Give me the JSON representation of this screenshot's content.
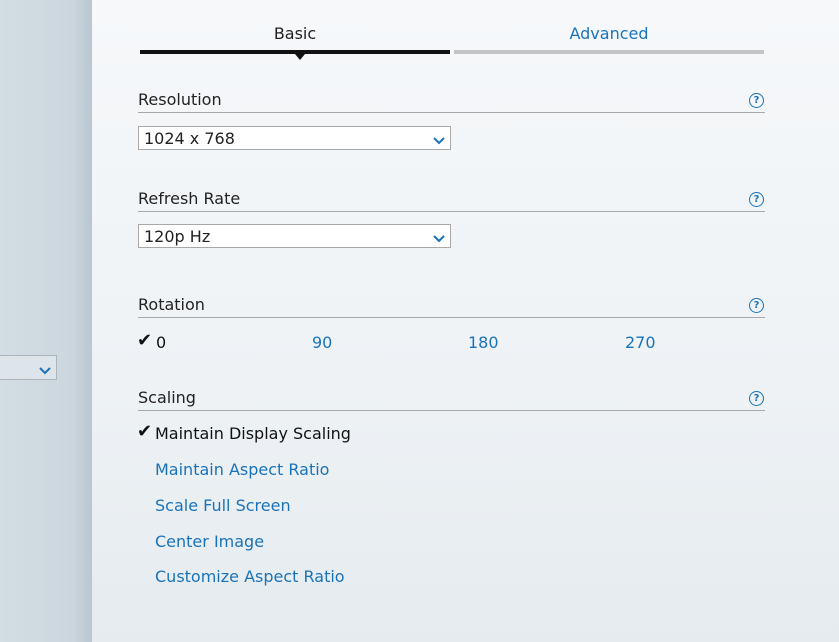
{
  "colors": {
    "accent": "#1a73b9",
    "text": "#222222",
    "tab_active": "#111111",
    "tab_inactive": "#c4c4c4"
  },
  "tabs": [
    {
      "label": "Basic",
      "active": true
    },
    {
      "label": "Advanced",
      "active": false
    }
  ],
  "resolution": {
    "title": "Resolution",
    "value": "1024 x 768",
    "help_icon": "help-icon"
  },
  "refresh_rate": {
    "title": "Refresh Rate",
    "value": "120p Hz",
    "help_icon": "help-icon"
  },
  "rotation": {
    "title": "Rotation",
    "options": [
      "0",
      "90",
      "180",
      "270"
    ],
    "selected": "0",
    "help_icon": "help-icon"
  },
  "scaling": {
    "title": "Scaling",
    "options": [
      "Maintain Display Scaling",
      "Maintain Aspect Ratio",
      "Scale Full Screen",
      "Center Image",
      "Customize Aspect Ratio"
    ],
    "selected": "Maintain Display Scaling",
    "help_icon": "help-icon"
  },
  "icons": {
    "check": "✔",
    "help": "?"
  }
}
